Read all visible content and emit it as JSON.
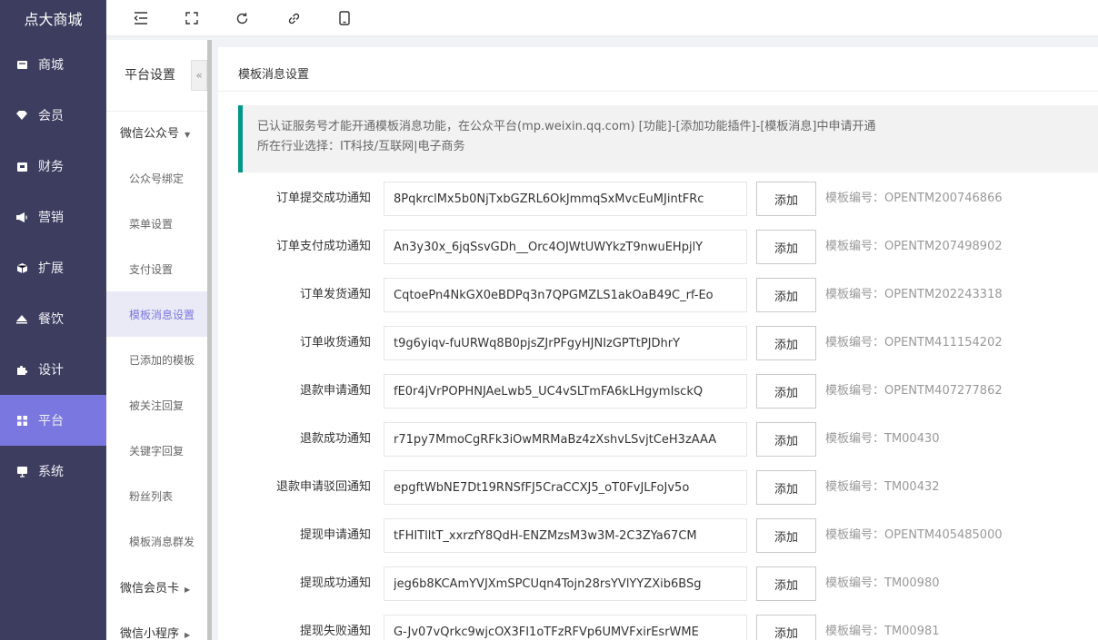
{
  "brand": "点大商城",
  "nav": [
    {
      "label": "商城",
      "icon": "store-icon"
    },
    {
      "label": "会员",
      "icon": "member-icon"
    },
    {
      "label": "财务",
      "icon": "finance-icon"
    },
    {
      "label": "营销",
      "icon": "megaphone-icon"
    },
    {
      "label": "扩展",
      "icon": "cube-icon"
    },
    {
      "label": "餐饮",
      "icon": "dining-icon"
    },
    {
      "label": "设计",
      "icon": "puzzle-icon"
    },
    {
      "label": "平台",
      "icon": "grid-icon"
    },
    {
      "label": "系统",
      "icon": "monitor-icon"
    }
  ],
  "active_nav": "平台",
  "topbar": {
    "icons": [
      "menu-collapse-icon",
      "fullscreen-icon",
      "refresh-icon",
      "link-icon",
      "mobile-icon"
    ]
  },
  "subnav": {
    "title": "平台设置",
    "collapse_glyph": "«",
    "groups": [
      {
        "label": "微信公众号",
        "caret": "▼"
      },
      {
        "label": "微信会员卡",
        "caret": "▶"
      },
      {
        "label": "微信小程序",
        "caret": "▶"
      }
    ],
    "items": [
      "公众号绑定",
      "菜单设置",
      "支付设置",
      "模板消息设置",
      "已添加的模板",
      "被关注回复",
      "关键字回复",
      "粉丝列表",
      "模板消息群发"
    ],
    "active_item": "模板消息设置"
  },
  "main": {
    "title": "模板消息设置",
    "notice_line1": "已认证服务号才能开通模板消息功能，在公众平台(mp.weixin.qq.com) [功能]-[添加功能插件]-[模板消息]中申请开通",
    "notice_line2": "所在行业选择：IT科技/互联网|电子商务",
    "add_label": "添加",
    "template_prefix": "模板编号：",
    "rows": [
      {
        "label": "订单提交成功通知",
        "value": "8PqkrclMx5b0NjTxbGZRL6OkJmmqSxMvcEuMJintFRc",
        "template": "模板编号：OPENTM200746866"
      },
      {
        "label": "订单支付成功通知",
        "value": "An3y30x_6jqSsvGDh__Orc4OJWtUWYkzT9nwuEHpjlY",
        "template": "模板编号：OPENTM207498902"
      },
      {
        "label": "订单发货通知",
        "value": "CqtoePn4NkGX0eBDPq3n7QPGMZLS1akOaB49C_rf-Eo",
        "template": "模板编号：OPENTM202243318"
      },
      {
        "label": "订单收货通知",
        "value": "t9g6yiqv-fuURWq8B0pjsZJrPFgyHJNIzGPTtPJDhrY",
        "template": "模板编号：OPENTM411154202"
      },
      {
        "label": "退款申请通知",
        "value": "fE0r4jVrPOPHNJAeLwb5_UC4vSLTmFA6kLHgymIsckQ",
        "template": "模板编号：OPENTM407277862"
      },
      {
        "label": "退款成功通知",
        "value": "r71py7MmoCgRFk3iOwMRMaBz4zXshvLSvjtCeH3zAAA",
        "template": "模板编号：TM00430"
      },
      {
        "label": "退款申请驳回通知",
        "value": "epgftWbNE7Dt19RNSfFJ5CraCCXJ5_oT0FvJLFoJv5o",
        "template": "模板编号：TM00432"
      },
      {
        "label": "提现申请通知",
        "value": "tFHITlltT_xxrzfY8QdH-ENZMzsM3w3M-2C3ZYa67CM",
        "template": "模板编号：OPENTM405485000"
      },
      {
        "label": "提现成功通知",
        "value": "jeg6b8KCAmYVJXmSPCUqn4Tojn28rsYVlYYZXib6BSg",
        "template": "模板编号：TM00980"
      },
      {
        "label": "提现失败通知",
        "value": "G-Jv07vQrkc9wjcOX3FI1oTFzRFVp6UMVFxirEsrWME",
        "template": "模板编号：TM00981"
      }
    ]
  },
  "colors": {
    "sidebar_bg": "#3c3d5f",
    "accent": "#7b77e0",
    "notice_border": "#009688"
  }
}
